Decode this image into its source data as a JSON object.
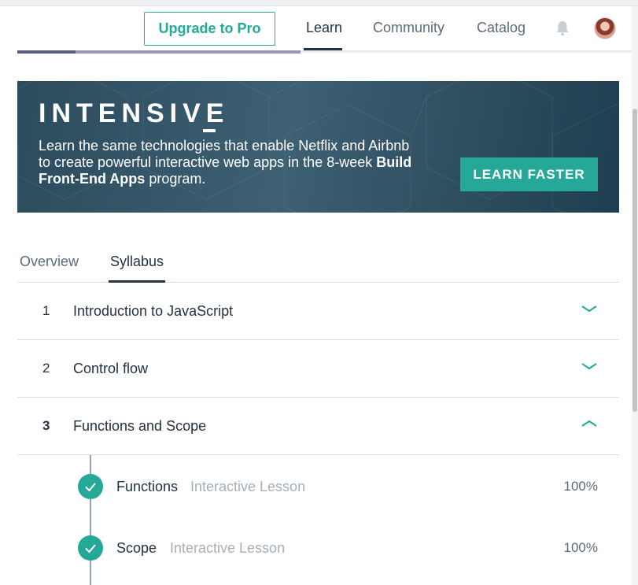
{
  "header": {
    "upgrade_label": "Upgrade to Pro",
    "nav": [
      {
        "label": "Learn",
        "active": true
      },
      {
        "label": "Community",
        "active": false
      },
      {
        "label": "Catalog",
        "active": false
      }
    ],
    "icons": [
      "bell-icon",
      "avatar"
    ]
  },
  "banner": {
    "title": "INTENSIVE",
    "desc_prefix": "Learn the same technologies that enable Netflix and Airbnb to create powerful interactive web apps in the 8-week ",
    "desc_bold": "Build Front-End Apps",
    "desc_suffix": " program.",
    "cta_label": "LEARN FASTER"
  },
  "tabs": [
    {
      "label": "Overview",
      "active": false
    },
    {
      "label": "Syllabus",
      "active": true
    }
  ],
  "syllabus": {
    "units": [
      {
        "number": "1",
        "title": "Introduction to JavaScript",
        "expanded": false
      },
      {
        "number": "2",
        "title": "Control flow",
        "expanded": false
      },
      {
        "number": "3",
        "title": "Functions and Scope",
        "expanded": true
      }
    ],
    "lessons": [
      {
        "title": "Functions",
        "type": "Interactive Lesson",
        "progress": "100%",
        "completed": true
      },
      {
        "title": "Scope",
        "type": "Interactive Lesson",
        "progress": "100%",
        "completed": true
      }
    ]
  },
  "colors": {
    "accent": "#25a898",
    "text_dark": "#253242",
    "text_muted": "#a6afb6",
    "banner_bg": "#2c4b5d"
  }
}
